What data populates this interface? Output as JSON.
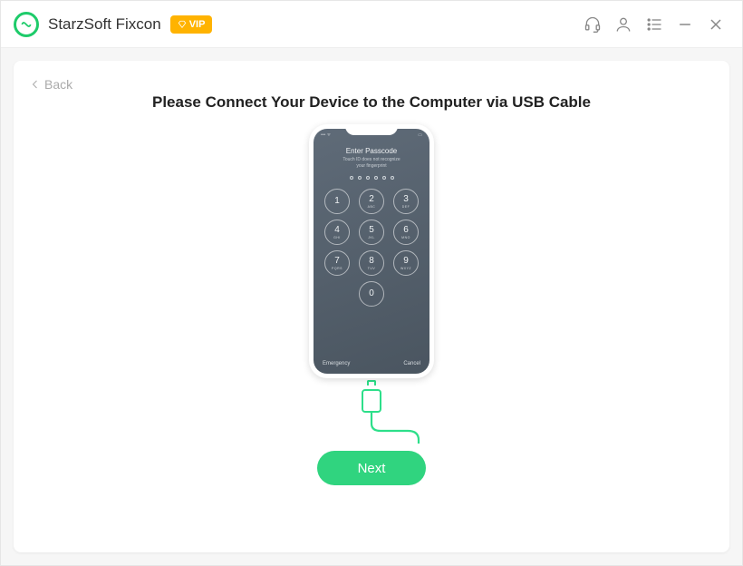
{
  "titlebar": {
    "app_name": "StarzSoft Fixcon",
    "vip_label": "VIP",
    "icons": {
      "headset": "headset-icon",
      "user": "user-icon",
      "menu": "menu-icon",
      "minimize": "minimize-icon",
      "close": "close-icon"
    }
  },
  "page": {
    "back_label": "Back",
    "heading": "Please Connect Your Device to the Computer via USB Cable",
    "next_label": "Next"
  },
  "phone": {
    "passcode_title": "Enter Passcode",
    "passcode_sub_line1": "Touch ID does not recognize",
    "passcode_sub_line2": "your fingerprint",
    "keys": [
      {
        "num": "1",
        "letters": ""
      },
      {
        "num": "2",
        "letters": "ABC"
      },
      {
        "num": "3",
        "letters": "DEF"
      },
      {
        "num": "4",
        "letters": "GHI"
      },
      {
        "num": "5",
        "letters": "JKL"
      },
      {
        "num": "6",
        "letters": "MNO"
      },
      {
        "num": "7",
        "letters": "PQRS"
      },
      {
        "num": "8",
        "letters": "TUV"
      },
      {
        "num": "9",
        "letters": "WXYZ"
      },
      {
        "num": "0",
        "letters": ""
      }
    ],
    "emergency": "Emergency",
    "cancel": "Cancel"
  },
  "colors": {
    "accent": "#30d47f",
    "vip": "#ffb300"
  }
}
